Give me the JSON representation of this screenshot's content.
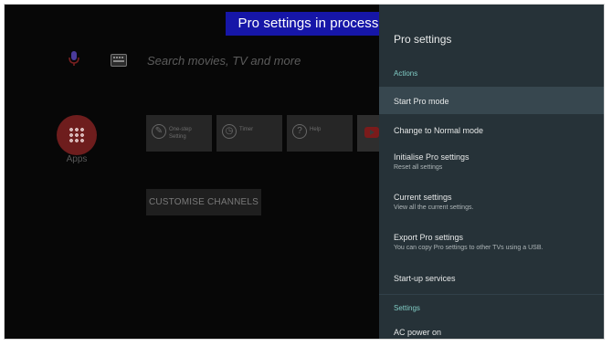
{
  "banner": {
    "text": "Pro settings in process"
  },
  "home": {
    "search_placeholder": "Search movies, TV and more",
    "mic_icon": "mic-icon",
    "keyboard_icon": "keyboard-icon",
    "apps_label": "Apps",
    "row_tiles": [
      {
        "label": "One-step Setting",
        "icon": "wrench-icon"
      },
      {
        "label": "Timer",
        "icon": "clock-icon"
      },
      {
        "label": "Help",
        "icon": "help-icon"
      }
    ],
    "customise_button": "CUSTOMISE CHANNELS"
  },
  "panel": {
    "title": "Pro settings",
    "sections": {
      "actions": "Actions",
      "settings": "Settings"
    },
    "items": [
      {
        "title": "Start Pro mode",
        "subtitle": "",
        "selected": true
      },
      {
        "title": "Change to Normal mode",
        "subtitle": ""
      },
      {
        "title": "Initialise Pro settings",
        "subtitle": "Reset all settings"
      },
      {
        "title": "Current settings",
        "subtitle": "View all the current settings."
      },
      {
        "title": "Export Pro settings",
        "subtitle": "You can copy Pro settings to other TVs using a USB."
      },
      {
        "title": "Start-up services",
        "subtitle": ""
      },
      {
        "title": "AC power on",
        "subtitle": ""
      }
    ]
  },
  "colors": {
    "banner_bg": "#1616a8",
    "panel_bg": "#263238",
    "selected_bg": "#37474f",
    "section_accent": "#80cbc4"
  }
}
